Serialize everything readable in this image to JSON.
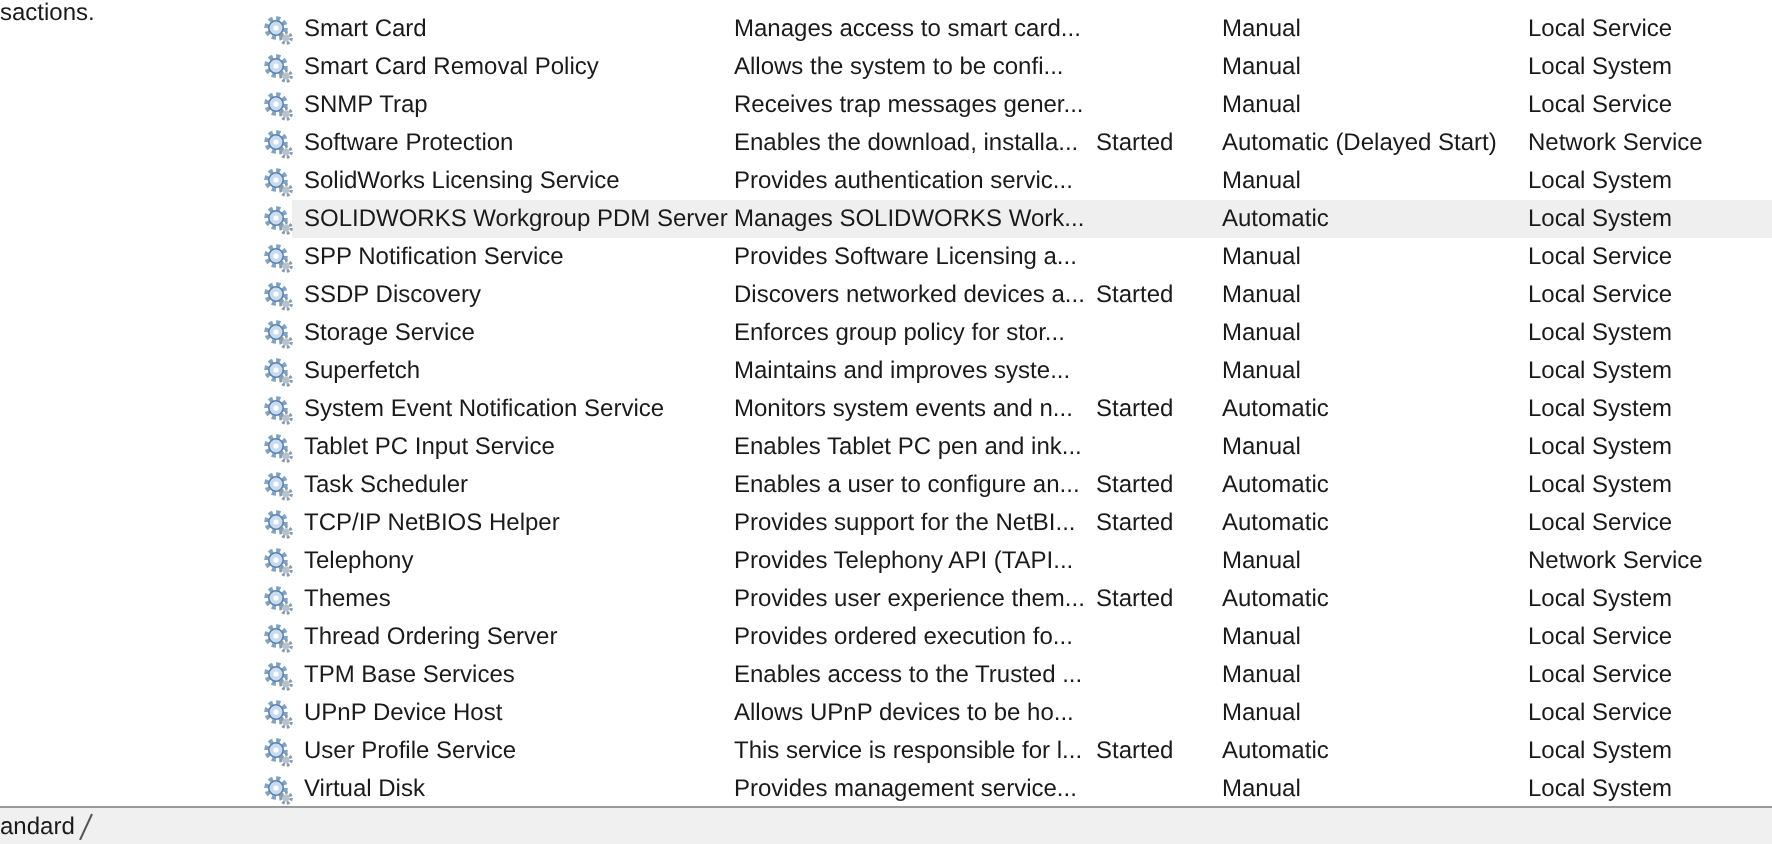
{
  "description_pane": {
    "text": "sactions."
  },
  "services": {
    "rows": [
      {
        "name": "Smart Card",
        "description": "Manages access to smart card...",
        "startup_type": "Manual",
        "log_on_as": "Local Service",
        "selected": false
      },
      {
        "name": "Smart Card Removal Policy",
        "description": "Allows the system to be confi...",
        "startup_type": "Manual",
        "log_on_as": "Local System",
        "selected": false
      },
      {
        "name": "SNMP Trap",
        "description": "Receives trap messages gener...",
        "startup_type": "Manual",
        "log_on_as": "Local Service",
        "selected": false
      },
      {
        "name": "Software Protection",
        "description": "Enables the download, installa...",
        "status": "Started",
        "startup_type": "Automatic (Delayed Start)",
        "log_on_as": "Network Service",
        "selected": false
      },
      {
        "name": "SolidWorks Licensing Service",
        "description": "Provides authentication servic...",
        "startup_type": "Manual",
        "log_on_as": "Local System",
        "selected": false
      },
      {
        "name": "SOLIDWORKS Workgroup PDM Server",
        "description": "Manages SOLIDWORKS Work...",
        "startup_type": "Automatic",
        "log_on_as": "Local System",
        "selected": true
      },
      {
        "name": "SPP Notification Service",
        "description": "Provides Software Licensing a...",
        "startup_type": "Manual",
        "log_on_as": "Local Service",
        "selected": false
      },
      {
        "name": "SSDP Discovery",
        "description": "Discovers networked devices a...",
        "status": "Started",
        "startup_type": "Manual",
        "log_on_as": "Local Service",
        "selected": false
      },
      {
        "name": "Storage Service",
        "description": "Enforces group policy for stor...",
        "startup_type": "Manual",
        "log_on_as": "Local System",
        "selected": false
      },
      {
        "name": "Superfetch",
        "description": "Maintains and improves syste...",
        "startup_type": "Manual",
        "log_on_as": "Local System",
        "selected": false
      },
      {
        "name": "System Event Notification Service",
        "description": "Monitors system events and n...",
        "status": "Started",
        "startup_type": "Automatic",
        "log_on_as": "Local System",
        "selected": false
      },
      {
        "name": "Tablet PC Input Service",
        "description": "Enables Tablet PC pen and ink...",
        "startup_type": "Manual",
        "log_on_as": "Local System",
        "selected": false
      },
      {
        "name": "Task Scheduler",
        "description": "Enables a user to configure an...",
        "status": "Started",
        "startup_type": "Automatic",
        "log_on_as": "Local System",
        "selected": false
      },
      {
        "name": "TCP/IP NetBIOS Helper",
        "description": "Provides support for the NetBI...",
        "status": "Started",
        "startup_type": "Automatic",
        "log_on_as": "Local Service",
        "selected": false
      },
      {
        "name": "Telephony",
        "description": "Provides Telephony API (TAPI...",
        "startup_type": "Manual",
        "log_on_as": "Network Service",
        "selected": false
      },
      {
        "name": "Themes",
        "description": "Provides user experience them...",
        "status": "Started",
        "startup_type": "Automatic",
        "log_on_as": "Local System",
        "selected": false
      },
      {
        "name": "Thread Ordering Server",
        "description": "Provides ordered execution fo...",
        "startup_type": "Manual",
        "log_on_as": "Local Service",
        "selected": false
      },
      {
        "name": "TPM Base Services",
        "description": "Enables access to the Trusted ...",
        "startup_type": "Manual",
        "log_on_as": "Local Service",
        "selected": false
      },
      {
        "name": "UPnP Device Host",
        "description": "Allows UPnP devices to be ho...",
        "startup_type": "Manual",
        "log_on_as": "Local Service",
        "selected": false
      },
      {
        "name": "User Profile Service",
        "description": "This service is responsible for l...",
        "status": "Started",
        "startup_type": "Automatic",
        "log_on_as": "Local System",
        "selected": false
      },
      {
        "name": "Virtual Disk",
        "description": "Provides management service...",
        "startup_type": "Manual",
        "log_on_as": "Local System",
        "selected": false
      }
    ]
  },
  "view_tabs": [
    {
      "label": "andard"
    }
  ]
}
